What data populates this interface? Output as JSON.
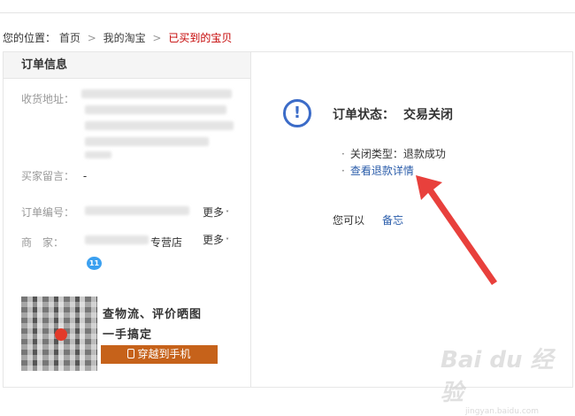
{
  "breadcrumb": {
    "prefix": "您的位置：",
    "items": [
      "首页",
      "我的淘宝"
    ],
    "separator": ">",
    "current": "已买到的宝贝"
  },
  "order_info": {
    "title": "订单信息",
    "address_label": "收货地址：",
    "buyer_message_label": "买家留言：",
    "buyer_message_value": "-",
    "order_number_label": "订单编号：",
    "seller_label": "商　家：",
    "seller_suffix": "专营店",
    "more_label": "更多"
  },
  "promo": {
    "line1": "查物流、评价晒图",
    "line2": "一手搞定",
    "button_label": "穿越到手机"
  },
  "status": {
    "label": "订单状态：",
    "value": "交易关闭",
    "close_type": "关闭类型：退款成功",
    "refund_link": "查看退款详情",
    "bullet": "·",
    "you_can": "您可以",
    "memo_link": "备忘"
  },
  "watermark": {
    "text": "Bai du 经验",
    "sub": "jingyan.baidu.com"
  },
  "colors": {
    "link": "#2a5caa",
    "current_crumb": "#c40000",
    "status_icon": "#3c6cc8",
    "promo_button": "#c6621a",
    "arrow": "#e8403c"
  }
}
